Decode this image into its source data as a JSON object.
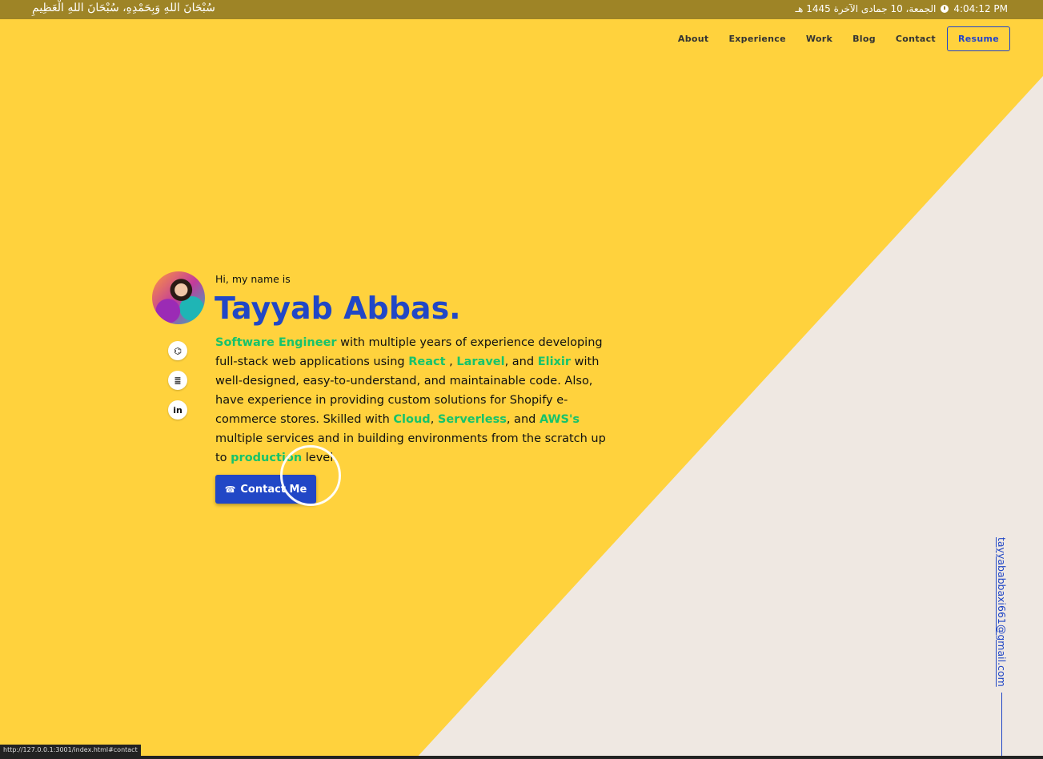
{
  "topbar": {
    "dhikr": "سُبْحَانَ اللهِ وَبِحَمْدِهِ، سُبْحَانَ اللهِ الْعَظِيمِ",
    "hijri_date": "الجمعة، 10 جمادى الآخرة 1445 هـ",
    "time": "4:04:12 PM"
  },
  "nav": {
    "items": [
      "About",
      "Experience",
      "Work",
      "Blog",
      "Contact"
    ],
    "resume_label": "Resume"
  },
  "hero": {
    "intro": "Hi, my name is",
    "name": "Tayyab Abbas.",
    "bio": {
      "role": "Software Engineer",
      "t1": " with multiple years of experience developing full-stack web applications using ",
      "react": "React",
      "t2": " , ",
      "laravel": "Laravel",
      "t3": ", and ",
      "elixir": "Elixir",
      "t4": " with well-designed, easy-to-understand, and maintainable code. Also, have experience in providing custom solutions for Shopify e-commerce stores. Skilled with ",
      "cloud": "Cloud",
      "t5": ", ",
      "serverless": "Serverless",
      "t6": ", and ",
      "aws": "AWS's",
      "t7": " multiple services and in building environments from the scratch up to ",
      "production": "production",
      "t8": " level."
    },
    "contact_label": "Contact Me",
    "socials": [
      {
        "icon": "github-icon",
        "glyph": "⌬"
      },
      {
        "icon": "stackoverflow-icon",
        "glyph": "≣"
      },
      {
        "icon": "linkedin-icon",
        "glyph": "in"
      }
    ]
  },
  "side_email": "tayyababbaxi661@gmail.com",
  "status_url": "http://127.0.0.1:3001/index.html#contact",
  "colors": {
    "accent_blue": "#2147c6",
    "highlight_green": "#16c36b",
    "yellow": "#ffd23d",
    "beige": "#efe8e2",
    "topbar": "#9e8426"
  }
}
